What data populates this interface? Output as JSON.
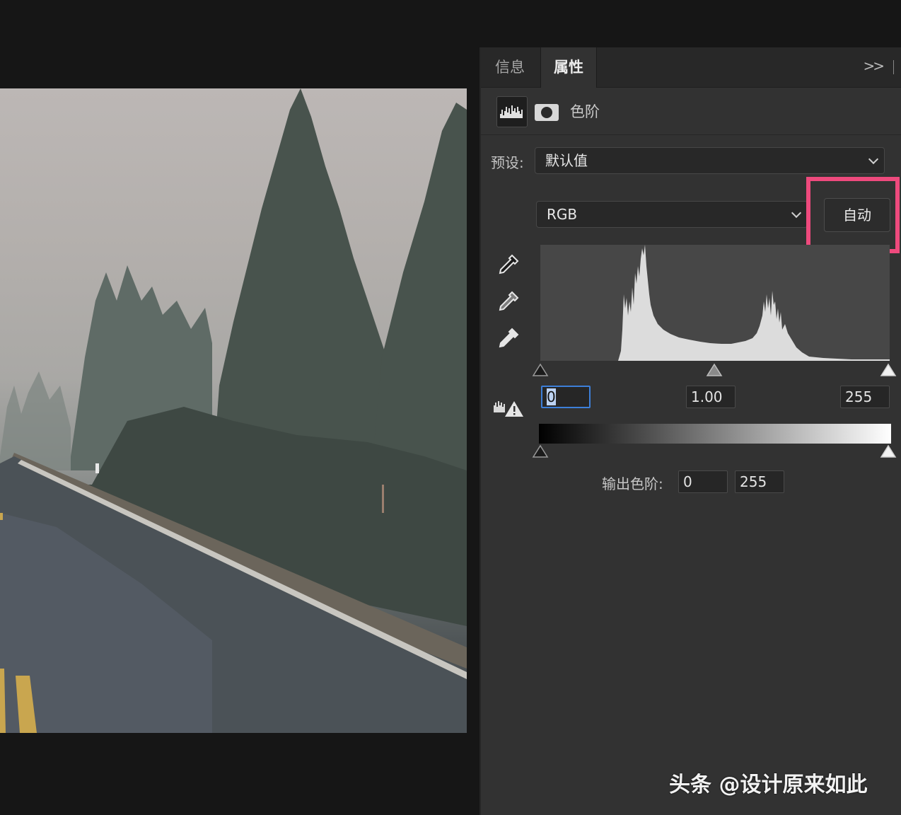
{
  "tabs": [
    {
      "label": "信息",
      "active": false
    },
    {
      "label": "属性",
      "active": true
    }
  ],
  "panel": {
    "collapse_icon": "double-chevron-right-icon",
    "title": "色阶",
    "adjustment_icon": "levels-histogram-icon",
    "mask_icon": "layer-mask-icon"
  },
  "preset": {
    "label": "预设:",
    "value": "默认值"
  },
  "channel": {
    "value": "RGB"
  },
  "auto_button": {
    "label": "自动",
    "highlight_color": "#ee4a7d"
  },
  "eyedroppers": [
    "black-point-eyedropper-icon",
    "gray-point-eyedropper-icon",
    "white-point-eyedropper-icon"
  ],
  "input_levels": {
    "black": "0",
    "gamma": "1.00",
    "white": "255"
  },
  "output_levels": {
    "label": "输出色阶:",
    "black": "0",
    "white": "255"
  },
  "watermark": "头条 @设计原来如此",
  "colors": {
    "panel_bg": "#323232",
    "tabbar_bg": "#282828",
    "canvas_bg": "#161616",
    "focus_blue": "#3d7fd8"
  }
}
